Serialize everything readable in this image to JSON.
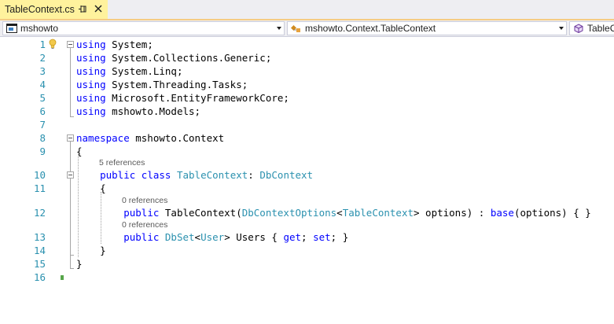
{
  "tab": {
    "title": "TableContext.cs",
    "pin_icon": "pin-icon",
    "close_icon": "close-icon"
  },
  "navbar": {
    "project": "mshowto",
    "type": "mshowto.Context.TableContext",
    "member": "TableCo"
  },
  "lines": [
    {
      "n": "1",
      "tokens": [
        {
          "t": "using",
          "c": "kw"
        },
        {
          "t": " System;",
          "c": ""
        }
      ]
    },
    {
      "n": "2",
      "tokens": [
        {
          "t": "using",
          "c": "kw"
        },
        {
          "t": " System.Collections.Generic;",
          "c": ""
        }
      ]
    },
    {
      "n": "3",
      "tokens": [
        {
          "t": "using",
          "c": "kw"
        },
        {
          "t": " System.Linq;",
          "c": ""
        }
      ]
    },
    {
      "n": "4",
      "tokens": [
        {
          "t": "using",
          "c": "kw"
        },
        {
          "t": " System.Threading.Tasks;",
          "c": ""
        }
      ]
    },
    {
      "n": "5",
      "tokens": [
        {
          "t": "using",
          "c": "kw"
        },
        {
          "t": " Microsoft.EntityFrameworkCore;",
          "c": ""
        }
      ]
    },
    {
      "n": "6",
      "tokens": [
        {
          "t": "using",
          "c": "kw"
        },
        {
          "t": " mshowto.Models;",
          "c": ""
        }
      ]
    },
    {
      "n": "7",
      "tokens": []
    },
    {
      "n": "8",
      "tokens": [
        {
          "t": "namespace",
          "c": "kw"
        },
        {
          "t": " mshowto.Context",
          "c": ""
        }
      ]
    },
    {
      "n": "9",
      "tokens": [
        {
          "t": "{",
          "c": ""
        }
      ]
    },
    {
      "n": "10",
      "lens": "5 references",
      "tokens": [
        {
          "t": "    ",
          "c": ""
        },
        {
          "t": "public",
          "c": "kw"
        },
        {
          "t": " ",
          "c": ""
        },
        {
          "t": "class",
          "c": "kw"
        },
        {
          "t": " ",
          "c": ""
        },
        {
          "t": "TableContext",
          "c": "ty"
        },
        {
          "t": ": ",
          "c": ""
        },
        {
          "t": "DbContext",
          "c": "ty"
        }
      ]
    },
    {
      "n": "11",
      "tokens": [
        {
          "t": "    {",
          "c": ""
        }
      ]
    },
    {
      "n": "12",
      "lens": "0 references",
      "tokens": [
        {
          "t": "        ",
          "c": ""
        },
        {
          "t": "public",
          "c": "kw"
        },
        {
          "t": " TableContext(",
          "c": ""
        },
        {
          "t": "DbContextOptions",
          "c": "ty"
        },
        {
          "t": "<",
          "c": ""
        },
        {
          "t": "TableContext",
          "c": "ty"
        },
        {
          "t": "> options) : ",
          "c": ""
        },
        {
          "t": "base",
          "c": "kw"
        },
        {
          "t": "(options) { }",
          "c": ""
        }
      ]
    },
    {
      "n": "13",
      "lens": "0 references",
      "tokens": [
        {
          "t": "        ",
          "c": ""
        },
        {
          "t": "public",
          "c": "kw"
        },
        {
          "t": " ",
          "c": ""
        },
        {
          "t": "DbSet",
          "c": "ty"
        },
        {
          "t": "<",
          "c": ""
        },
        {
          "t": "User",
          "c": "ty"
        },
        {
          "t": "> Users { ",
          "c": ""
        },
        {
          "t": "get",
          "c": "kw"
        },
        {
          "t": "; ",
          "c": ""
        },
        {
          "t": "set",
          "c": "kw"
        },
        {
          "t": "; }",
          "c": ""
        }
      ]
    },
    {
      "n": "14",
      "tokens": [
        {
          "t": "    }",
          "c": ""
        }
      ]
    },
    {
      "n": "15",
      "tokens": [
        {
          "t": "}",
          "c": ""
        }
      ]
    },
    {
      "n": "16",
      "tokens": []
    }
  ],
  "colors": {
    "keyword": "#0000ff",
    "type": "#2b91af",
    "line_number": "#2b91af",
    "tab_active": "#fff29d",
    "codelens": "#5a5a5a"
  }
}
